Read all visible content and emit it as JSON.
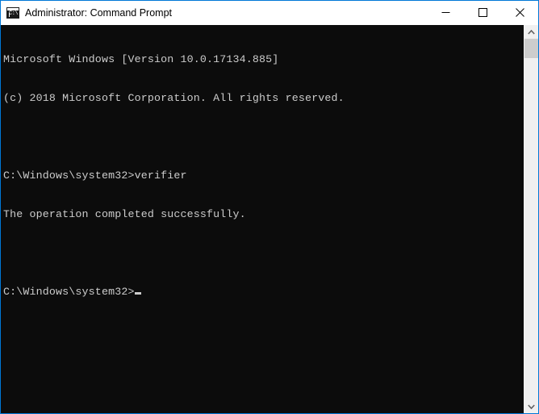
{
  "window": {
    "title": "Administrator: Command Prompt",
    "icon": "console-icon",
    "icon_glyph": "C:\\",
    "border_color": "#0078d7",
    "titlebar_background": "#ffffff",
    "titlebar_text_color": "#000000"
  },
  "window_controls": {
    "minimize": {
      "name": "minimize-button",
      "label": "Minimize"
    },
    "maximize": {
      "name": "maximize-button",
      "label": "Maximize"
    },
    "close": {
      "name": "close-button",
      "label": "Close"
    }
  },
  "console": {
    "background": "#0c0c0c",
    "foreground": "#cccccc",
    "lines": [
      "Microsoft Windows [Version 10.0.17134.885]",
      "(c) 2018 Microsoft Corporation. All rights reserved.",
      "",
      "C:\\Windows\\system32>verifier",
      "The operation completed successfully.",
      "",
      "C:\\Windows\\system32>"
    ],
    "prompt": "C:\\Windows\\system32>",
    "last_command": "verifier",
    "status_message": "The operation completed successfully.",
    "os_version_line": "Microsoft Windows [Version 10.0.17134.885]",
    "copyright_line": "(c) 2018 Microsoft Corporation. All rights reserved.",
    "cursor": "_"
  },
  "scrollbar": {
    "up_arrow": "scroll-up-arrow",
    "down_arrow": "scroll-down-arrow",
    "thumb": "scroll-thumb",
    "track_color": "#f0f0f0",
    "thumb_color": "#cdcdcd"
  }
}
